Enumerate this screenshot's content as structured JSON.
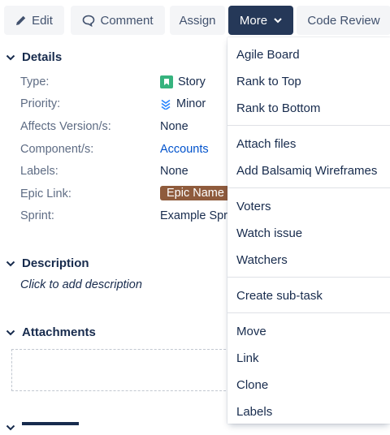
{
  "toolbar": {
    "edit_label": "Edit",
    "comment_label": "Comment",
    "assign_label": "Assign",
    "more_label": "More",
    "code_review_label": "Code Review"
  },
  "details": {
    "heading": "Details",
    "fields": [
      {
        "label": "Type:",
        "value": "Story"
      },
      {
        "label": "Priority:",
        "value": "Minor"
      },
      {
        "label": "Affects Version/s:",
        "value": "None"
      },
      {
        "label": "Component/s:",
        "value": "Accounts"
      },
      {
        "label": "Labels:",
        "value": "None"
      },
      {
        "label": "Epic Link:",
        "value": "Epic Name"
      },
      {
        "label": "Sprint:",
        "value": "Example Spr"
      }
    ]
  },
  "description": {
    "heading": "Description",
    "placeholder": "Click to add description"
  },
  "attachments": {
    "heading": "Attachments"
  },
  "dropdown": {
    "groups": [
      [
        "Agile Board",
        "Rank to Top",
        "Rank to Bottom"
      ],
      [
        "Attach files",
        "Add Balsamiq Wireframes"
      ],
      [
        "Voters",
        "Watch issue",
        "Watchers"
      ],
      [
        "Create sub-task"
      ],
      [
        "Move",
        "Link",
        "Clone",
        "Labels"
      ]
    ]
  },
  "colors": {
    "accent": "#253858",
    "link": "#0052cc",
    "story": "#36b37e",
    "priority_minor": "#2684ff",
    "epic": "#8f5b3c"
  }
}
